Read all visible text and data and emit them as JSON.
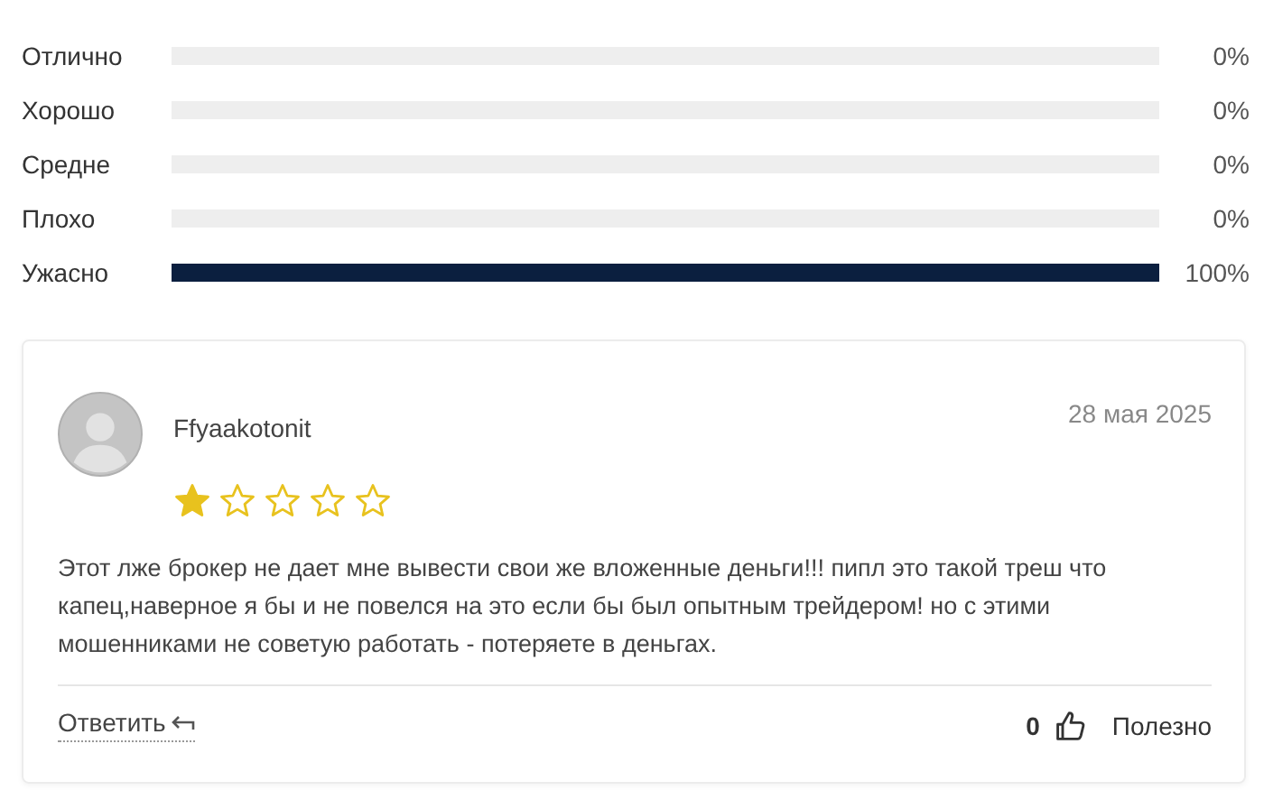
{
  "ratings": [
    {
      "label": "Отлично",
      "level": 0,
      "percent": "0%"
    },
    {
      "label": "Хорошо",
      "level": 0,
      "percent": "0%"
    },
    {
      "label": "Средне",
      "level": 0,
      "percent": "0%"
    },
    {
      "label": "Плохо",
      "level": 0,
      "percent": "0%"
    },
    {
      "label": "Ужасно",
      "level": 1,
      "percent": "100%"
    }
  ],
  "review": {
    "author": "Ffyaakotonit",
    "date": "28 мая 2025",
    "stars": 1,
    "text": "Этот лже брокер не дает мне вывести свои же вложенные деньги!!! пипл это такой треш что капец,наверное я бы и не повелся на это если бы был опытным трейдером! но с этими мошенниками не советую работать - потеряете в деньгах.",
    "reply": "Ответить",
    "helpful_count": "0",
    "helpful_label": "Полезно"
  }
}
